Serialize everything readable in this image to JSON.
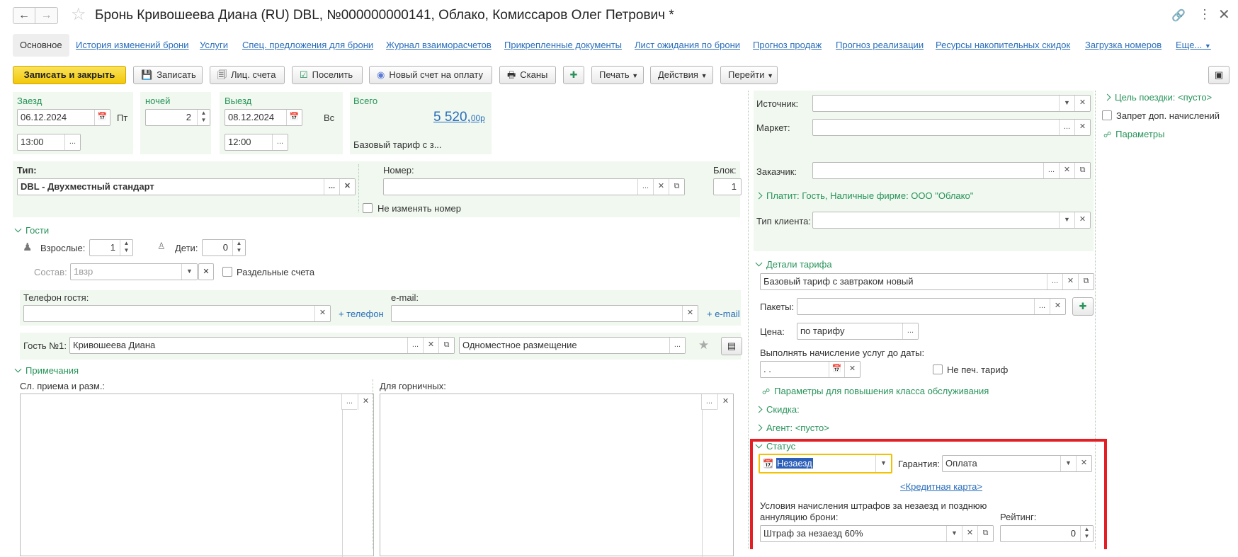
{
  "window": {
    "title": "Бронь Кривошеева Диана (RU) DBL, №000000000141, Облако, Комиссаров Олег Петрович *"
  },
  "tabs": [
    "Основное",
    "История изменений брони",
    "Услуги",
    "Спец. предложения для брони",
    "Журнал взаиморасчетов",
    "Прикрепленные документы",
    "Лист ожидания по брони",
    "Прогноз продаж",
    "Прогноз реализации",
    "Ресурсы накопительных скидок",
    "Загрузка номеров",
    "Еще..."
  ],
  "toolbar": {
    "save_close": "Записать и закрыть",
    "save": "Записать",
    "personal_account": "Лиц. счета",
    "checkin": "Поселить",
    "new_invoice": "Новый счет на оплату",
    "scans": "Сканы",
    "print": "Печать",
    "actions": "Действия",
    "goto": "Перейти"
  },
  "dates": {
    "arrival_label": "Заезд",
    "arrival_date": "06.12.2024",
    "arrival_dow": "Пт",
    "arrival_time": "13:00",
    "nights_label": "ночей",
    "nights": "2",
    "departure_label": "Выезд",
    "departure_date": "08.12.2024",
    "departure_dow": "Вс",
    "departure_time": "12:00",
    "total_label": "Всего",
    "total_main": "5 520,",
    "total_cents": "00р",
    "tariff_short": "Базовый тариф с з..."
  },
  "room": {
    "type_label": "Тип:",
    "type_value": "DBL - Двухместный стандарт",
    "number_label": "Номер:",
    "number_value": "",
    "block_label": "Блок:",
    "block_value": "1",
    "keep_room": "Не изменять номер"
  },
  "guests": {
    "section": "Гости",
    "adults_label": "Взрослые:",
    "adults": "1",
    "children_label": "Дети:",
    "children": "0",
    "composition_label": "Состав:",
    "composition": "1взр",
    "separate_accounts": "Раздельные счета",
    "phone_label": "Телефон гостя:",
    "add_phone": "+ телефон",
    "email_label": "e-mail:",
    "add_email": "+ e-mail",
    "guest1_label": "Гость №1:",
    "guest1_name": "Кривошеева Диана",
    "placement": "Одноместное размещение"
  },
  "notes": {
    "section": "Примечания",
    "reception_label": "Сл. приема и разм.:",
    "housekeeping_label": "Для горничных:"
  },
  "right": {
    "source_label": "Источник:",
    "market_label": "Маркет:",
    "customer_label": "Заказчик:",
    "payer": "Платит: Гость, Наличные фирме: ООО \"Облако\"",
    "client_type_label": "Тип клиента:",
    "tariff_section": "Детали тарифа",
    "tariff_value": "Базовый тариф с завтраком новый",
    "packages_label": "Пакеты:",
    "price_label": "Цена:",
    "price_value": "по тарифу",
    "charge_until_label": "Выполнять начисление услуг до даты:",
    "charge_until_value": " .  .",
    "no_print_tariff": "Не печ. тариф",
    "upgrade_params": "Параметры для повышения класса обслуживания",
    "discount": "Скидка:",
    "agent": "Агент: <пусто>",
    "status_section": "Статус",
    "status_value": "Незаезд",
    "guarantee_label": "Гарантия:",
    "guarantee_value": "Оплата",
    "credit_card": "<Кредитная карта>",
    "penalty_label_1": "Условия начисления штрафов за незаезд и позднюю",
    "penalty_label_2": "аннуляцию брони:",
    "penalty_value": "Штраф за незаезд 60%",
    "rating_label": "Рейтинг:",
    "rating_value": "0"
  },
  "side": {
    "trip_purpose": "Цель поездки: <пусто>",
    "no_extra_charges": "Запрет доп. начислений",
    "params": "Параметры"
  },
  "colors": {
    "accent": "#28935a",
    "link": "#2a6ebb",
    "highlight": "#e31e24",
    "primary_button": "#f7d21b"
  }
}
